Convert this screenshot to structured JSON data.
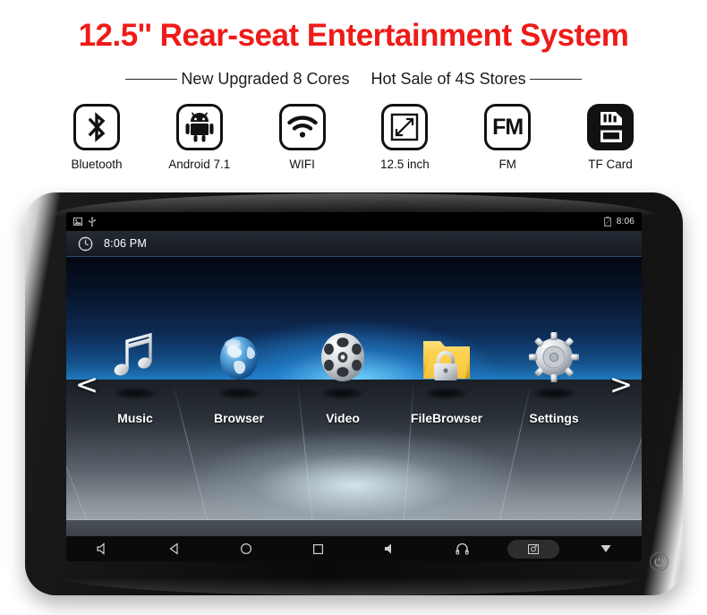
{
  "header": {
    "title": "12.5'' Rear-seat Entertainment System",
    "subtitle_left": "New Upgraded 8 Cores",
    "subtitle_right": "Hot Sale of 4S Stores",
    "title_color": "#ee1b18"
  },
  "features": [
    {
      "icon": "bluetooth-icon",
      "label": "Bluetooth"
    },
    {
      "icon": "android-robot-icon",
      "label": "Android 7.1"
    },
    {
      "icon": "wifi-icon",
      "label": "WIFI"
    },
    {
      "icon": "screen-size-icon",
      "label": "12.5 inch"
    },
    {
      "icon": "fm-radio-icon",
      "label": "FM"
    },
    {
      "icon": "sd-card-icon",
      "label": "TF Card"
    }
  ],
  "device": {
    "statusbar": {
      "left_icons": [
        "screenshot-icon",
        "usb-icon"
      ],
      "right_icons": [
        "battery-icon"
      ],
      "time": "8:06"
    },
    "notification": {
      "icon": "clock-icon",
      "time": "8:06 PM"
    },
    "launcher": {
      "prev_arrow": "<",
      "next_arrow": ">",
      "apps": [
        {
          "icon": "music-note-icon",
          "label": "Music"
        },
        {
          "icon": "globe-browser-icon",
          "label": "Browser"
        },
        {
          "icon": "film-reel-icon",
          "label": "Video"
        },
        {
          "icon": "locked-folder-icon",
          "label": "FileBrowser"
        },
        {
          "icon": "gear-settings-icon",
          "label": "Settings"
        }
      ]
    },
    "navbar": [
      {
        "icon": "volume-down-icon",
        "name": "volume-down"
      },
      {
        "icon": "back-icon",
        "name": "back"
      },
      {
        "icon": "home-icon",
        "name": "home"
      },
      {
        "icon": "recents-icon",
        "name": "recents"
      },
      {
        "icon": "volume-up-icon",
        "name": "volume-up"
      },
      {
        "icon": "headphones-icon",
        "name": "headphones"
      },
      {
        "icon": "screenshot-camera-icon",
        "name": "screenshot"
      },
      {
        "icon": "collapse-down-icon",
        "name": "collapse"
      }
    ],
    "power_button_icon": "power-icon"
  }
}
